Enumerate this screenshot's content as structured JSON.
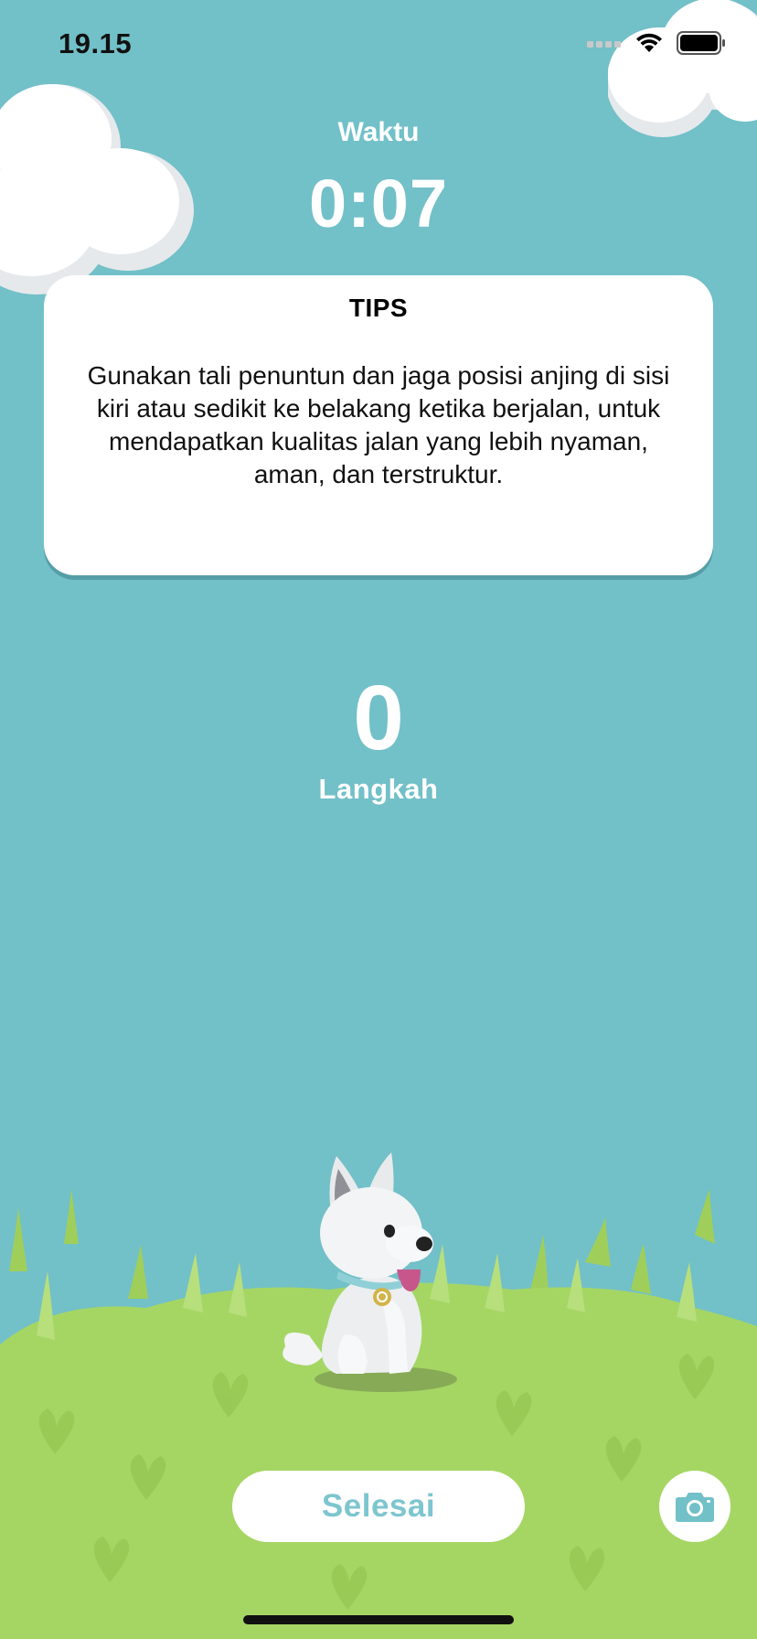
{
  "status_bar": {
    "time": "19.15",
    "signal_icon": "cellular-signal-icon",
    "wifi_icon": "wifi-icon",
    "battery_icon": "battery-icon"
  },
  "timer": {
    "label": "Waktu",
    "value": "0:07"
  },
  "tips": {
    "title": "TIPS",
    "body": "Gunakan tali penuntun dan jaga posisi anjing di sisi kiri atau sedikit ke belakang ketika berjalan, untuk mendapatkan kualitas jalan yang lebih nyaman, aman, dan terstruktur."
  },
  "steps": {
    "value": "0",
    "label": "Langkah"
  },
  "actions": {
    "finish_label": "Selesai",
    "camera_icon": "camera-icon"
  },
  "colors": {
    "sky": "#72c0c8",
    "grass": "#a5d664",
    "accent": "#7ec6cf"
  }
}
